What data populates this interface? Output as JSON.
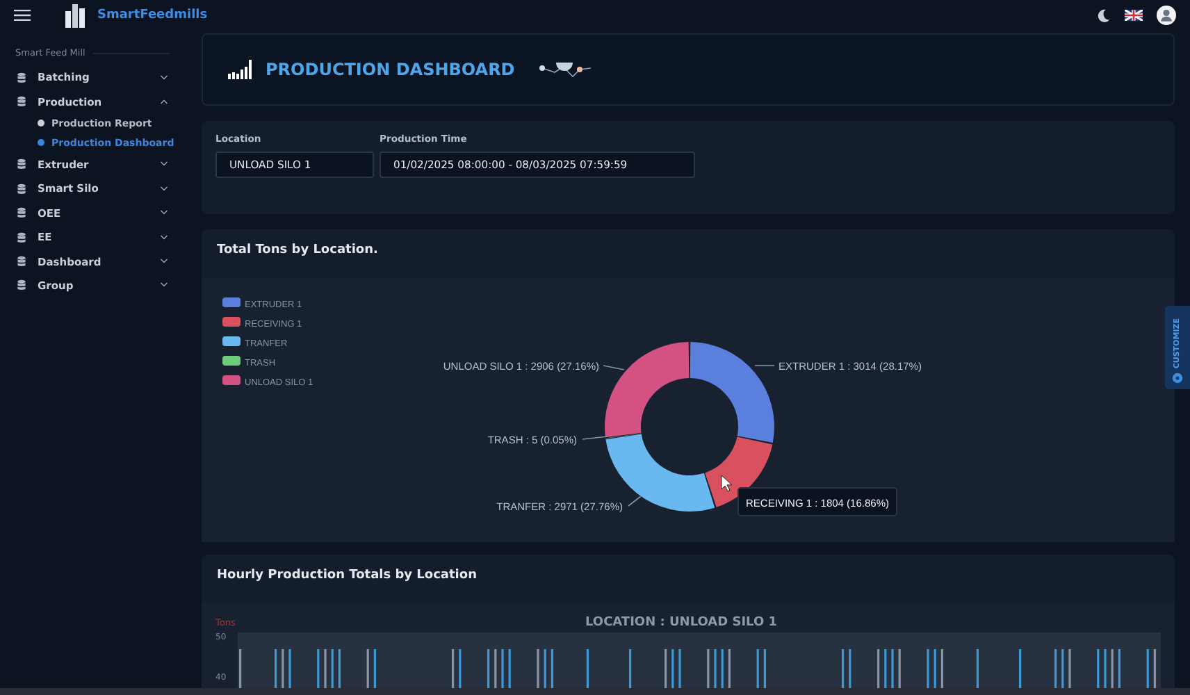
{
  "topbar": {
    "brand": "SmartFeedmills"
  },
  "sidebar": {
    "section": "Smart Feed Mill",
    "items": [
      {
        "label": "Batching",
        "expanded": false
      },
      {
        "label": "Production",
        "expanded": true,
        "children": [
          {
            "label": "Production Report",
            "selected": false
          },
          {
            "label": "Production Dashboard",
            "selected": true
          }
        ]
      },
      {
        "label": "Extruder",
        "expanded": false
      },
      {
        "label": "Smart Silo",
        "expanded": false
      },
      {
        "label": "OEE",
        "expanded": false
      },
      {
        "label": "EE",
        "expanded": false
      },
      {
        "label": "Dashboard",
        "expanded": false
      },
      {
        "label": "Group",
        "expanded": false
      }
    ]
  },
  "page_title": "PRODUCTION DASHBOARD",
  "filters": [
    {
      "label": "Location",
      "value": "UNLOAD SILO 1"
    },
    {
      "label": "Production Time",
      "value": "01/02/2025 08:00:00 - 08/03/2025 07:59:59"
    }
  ],
  "donut": {
    "title": "Total Tons by Location.",
    "chart_data": {
      "type": "donut",
      "categories": [
        "EXTRUDER 1",
        "RECEIVING 1",
        "TRANFER",
        "TRASH",
        "UNLOAD SILO 1"
      ],
      "values": [
        28.17,
        16.86,
        27.76,
        0.05,
        27.16
      ],
      "colors": [
        "#5b7fdc",
        "#d9505f",
        "#6ab8f0",
        "#6ccc7a",
        "#d45183"
      ],
      "legend": "left"
    },
    "labels": [
      {
        "text": "UNLOAD SILO 1 : 2906 (27.16%)"
      },
      {
        "text": "EXTRUDER 1 : 3014 (28.17%)"
      },
      {
        "text": "TRASH : 5 (0.05%)"
      },
      {
        "text": "TRANFER : 2971 (27.76%)"
      }
    ],
    "tooltip": "RECEIVING 1 : 1804 (16.86%)"
  },
  "hourly": {
    "title": "Hourly Production Totals by Location",
    "chart_title": "LOCATION : UNLOAD SILO 1",
    "ylabel": "Tons",
    "yticks": [
      "50",
      "40"
    ]
  },
  "customize": "CUSTOMIZE"
}
